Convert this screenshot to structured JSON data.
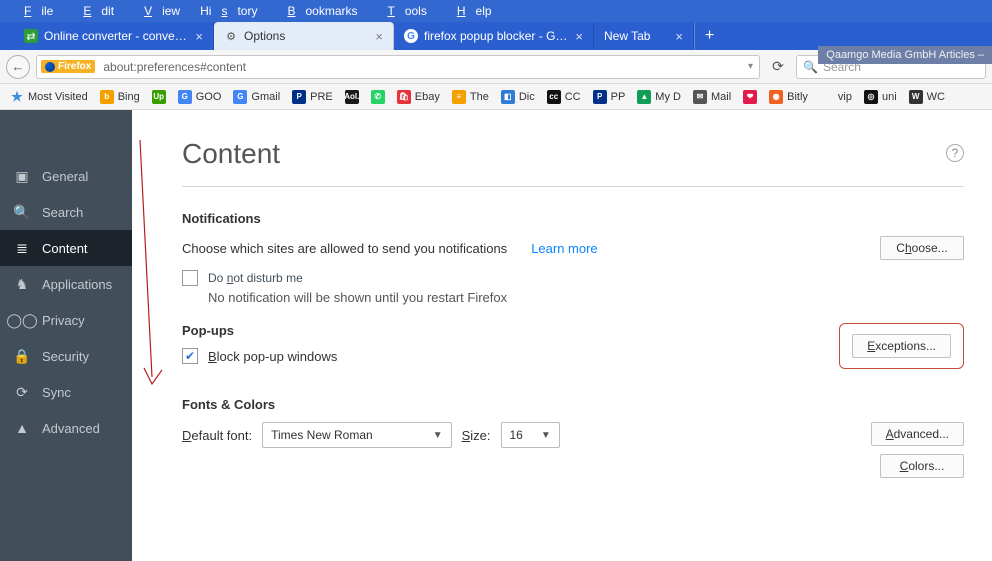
{
  "menubar": [
    "File",
    "Edit",
    "View",
    "History",
    "Bookmarks",
    "Tools",
    "Help"
  ],
  "tabs": [
    {
      "title": "Online converter - convert ...",
      "active": false,
      "favicon_bg": "#2a9d3a"
    },
    {
      "title": "Options",
      "active": true,
      "favicon": "⚙"
    },
    {
      "title": "firefox popup blocker - Goo...",
      "active": false,
      "favicon": "G"
    },
    {
      "title": "New Tab",
      "active": false,
      "newtab": true
    }
  ],
  "banner": "Qaamgo Media GmbH Articles –",
  "url": {
    "identity": "Firefox",
    "address": "about:preferences#content"
  },
  "search": {
    "placeholder": "Search"
  },
  "bookmarks": [
    {
      "ic": "★",
      "label": "Most Visited",
      "col": "#3a8edb"
    },
    {
      "ic": "b",
      "label": "Bing",
      "col": "#f4a100"
    },
    {
      "ic": "Up",
      "label": "",
      "col": "#37a000"
    },
    {
      "ic": "G",
      "label": "GOO",
      "col": "#4285f4"
    },
    {
      "ic": "G",
      "label": "Gmail",
      "col": "#4285f4"
    },
    {
      "ic": "P",
      "label": "PRE",
      "col": "#003087"
    },
    {
      "ic": "Aol.",
      "label": "",
      "col": "#1a1a1a"
    },
    {
      "ic": "✆",
      "label": "",
      "col": "#25d366"
    },
    {
      "ic": "🛍",
      "label": "Ebay",
      "col": "#e53238"
    },
    {
      "ic": "≡",
      "label": "The",
      "col": "#f4a100"
    },
    {
      "ic": "◧",
      "label": "Dic",
      "col": "#2d7bd6"
    },
    {
      "ic": "cc",
      "label": "CC",
      "col": "#111"
    },
    {
      "ic": "P",
      "label": "PP",
      "col": "#003087"
    },
    {
      "ic": "▲",
      "label": "My D",
      "col": "#0f9d58"
    },
    {
      "ic": "✉",
      "label": "Mail",
      "col": "#555"
    },
    {
      "ic": "❤",
      "label": "",
      "col": "#e21b4d"
    },
    {
      "ic": "◉",
      "label": "Bitly",
      "col": "#ee6123"
    },
    {
      "ic": "",
      "label": "vip",
      "col": ""
    },
    {
      "ic": "◎",
      "label": "uni",
      "col": "#111"
    },
    {
      "ic": "W",
      "label": "WC",
      "col": "#333"
    }
  ],
  "sidebar": [
    {
      "icon": "▣",
      "label": "General"
    },
    {
      "icon": "🔍",
      "label": "Search"
    },
    {
      "icon": "≣",
      "label": "Content",
      "active": true
    },
    {
      "icon": "♞",
      "label": "Applications"
    },
    {
      "icon": "◯◯",
      "label": "Privacy"
    },
    {
      "icon": "🔒",
      "label": "Security"
    },
    {
      "icon": "⟳",
      "label": "Sync"
    },
    {
      "icon": "▲",
      "label": "Advanced"
    }
  ],
  "page": {
    "title": "Content",
    "notifications": {
      "heading": "Notifications",
      "desc": "Choose which sites are allowed to send you notifications",
      "learn": "Learn more",
      "choose": "Choose...",
      "dnd": "Do not disturb me",
      "dnd_sub": "No notification will be shown until you restart Firefox"
    },
    "popups": {
      "heading": "Pop-ups",
      "block": "Block pop-up windows",
      "exceptions": "Exceptions..."
    },
    "fonts": {
      "heading": "Fonts & Colors",
      "default_label": "Default font:",
      "default_value": "Times New Roman",
      "size_label": "Size:",
      "size_value": "16",
      "advanced": "Advanced...",
      "colors": "Colors..."
    }
  }
}
